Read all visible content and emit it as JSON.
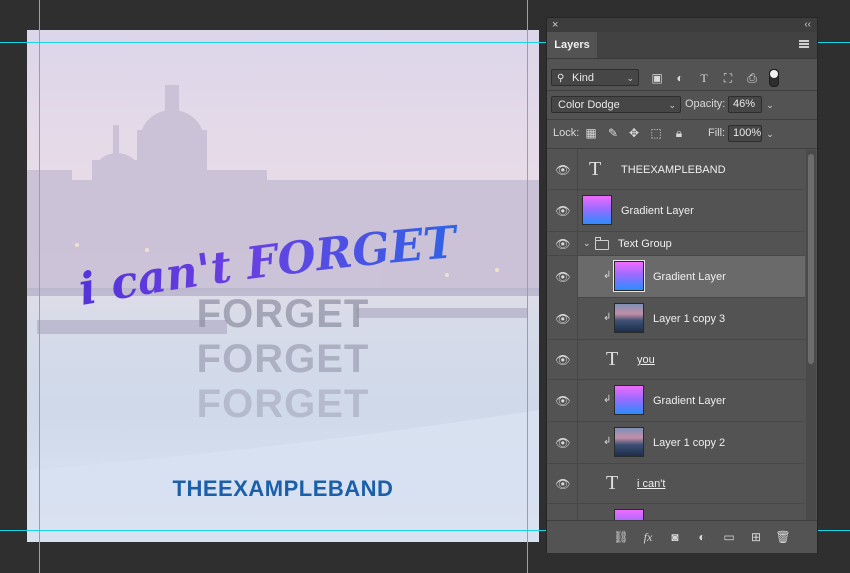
{
  "canvas": {
    "title_text": "i can't FORGET you",
    "echo_words": [
      "FORGET",
      "FORGET",
      "FORGET"
    ],
    "band_name": "THEEXAMPLEBAND"
  },
  "panel": {
    "close": "×",
    "collapse": "‹‹",
    "tab": "Layers",
    "filter_kind": "Kind",
    "blend_mode": "Color Dodge",
    "opacity_label": "Opacity:",
    "opacity_value": "46%",
    "lock_label": "Lock:",
    "fill_label": "Fill:",
    "fill_value": "100%",
    "layers": [
      {
        "name": "THEEXAMPLEBAND",
        "kind": "text",
        "underline": false
      },
      {
        "name": "Gradient Layer",
        "kind": "gradient",
        "underline": false
      },
      {
        "name": "Text Group",
        "kind": "group",
        "underline": false
      },
      {
        "name": "Gradient Layer",
        "kind": "gradient",
        "selected": true,
        "clipped": true
      },
      {
        "name": "Layer 1 copy 3",
        "kind": "photo",
        "clipped": true
      },
      {
        "name": "you",
        "kind": "text",
        "underline": true
      },
      {
        "name": "Gradient Layer",
        "kind": "gradient",
        "clipped": true
      },
      {
        "name": "Layer 1 copy 2",
        "kind": "photo",
        "clipped": true
      },
      {
        "name": "i can't",
        "kind": "text",
        "underline": true
      }
    ],
    "icons": {
      "visibility": "eye-icon",
      "type_layer": "T",
      "clip": "↲"
    }
  }
}
